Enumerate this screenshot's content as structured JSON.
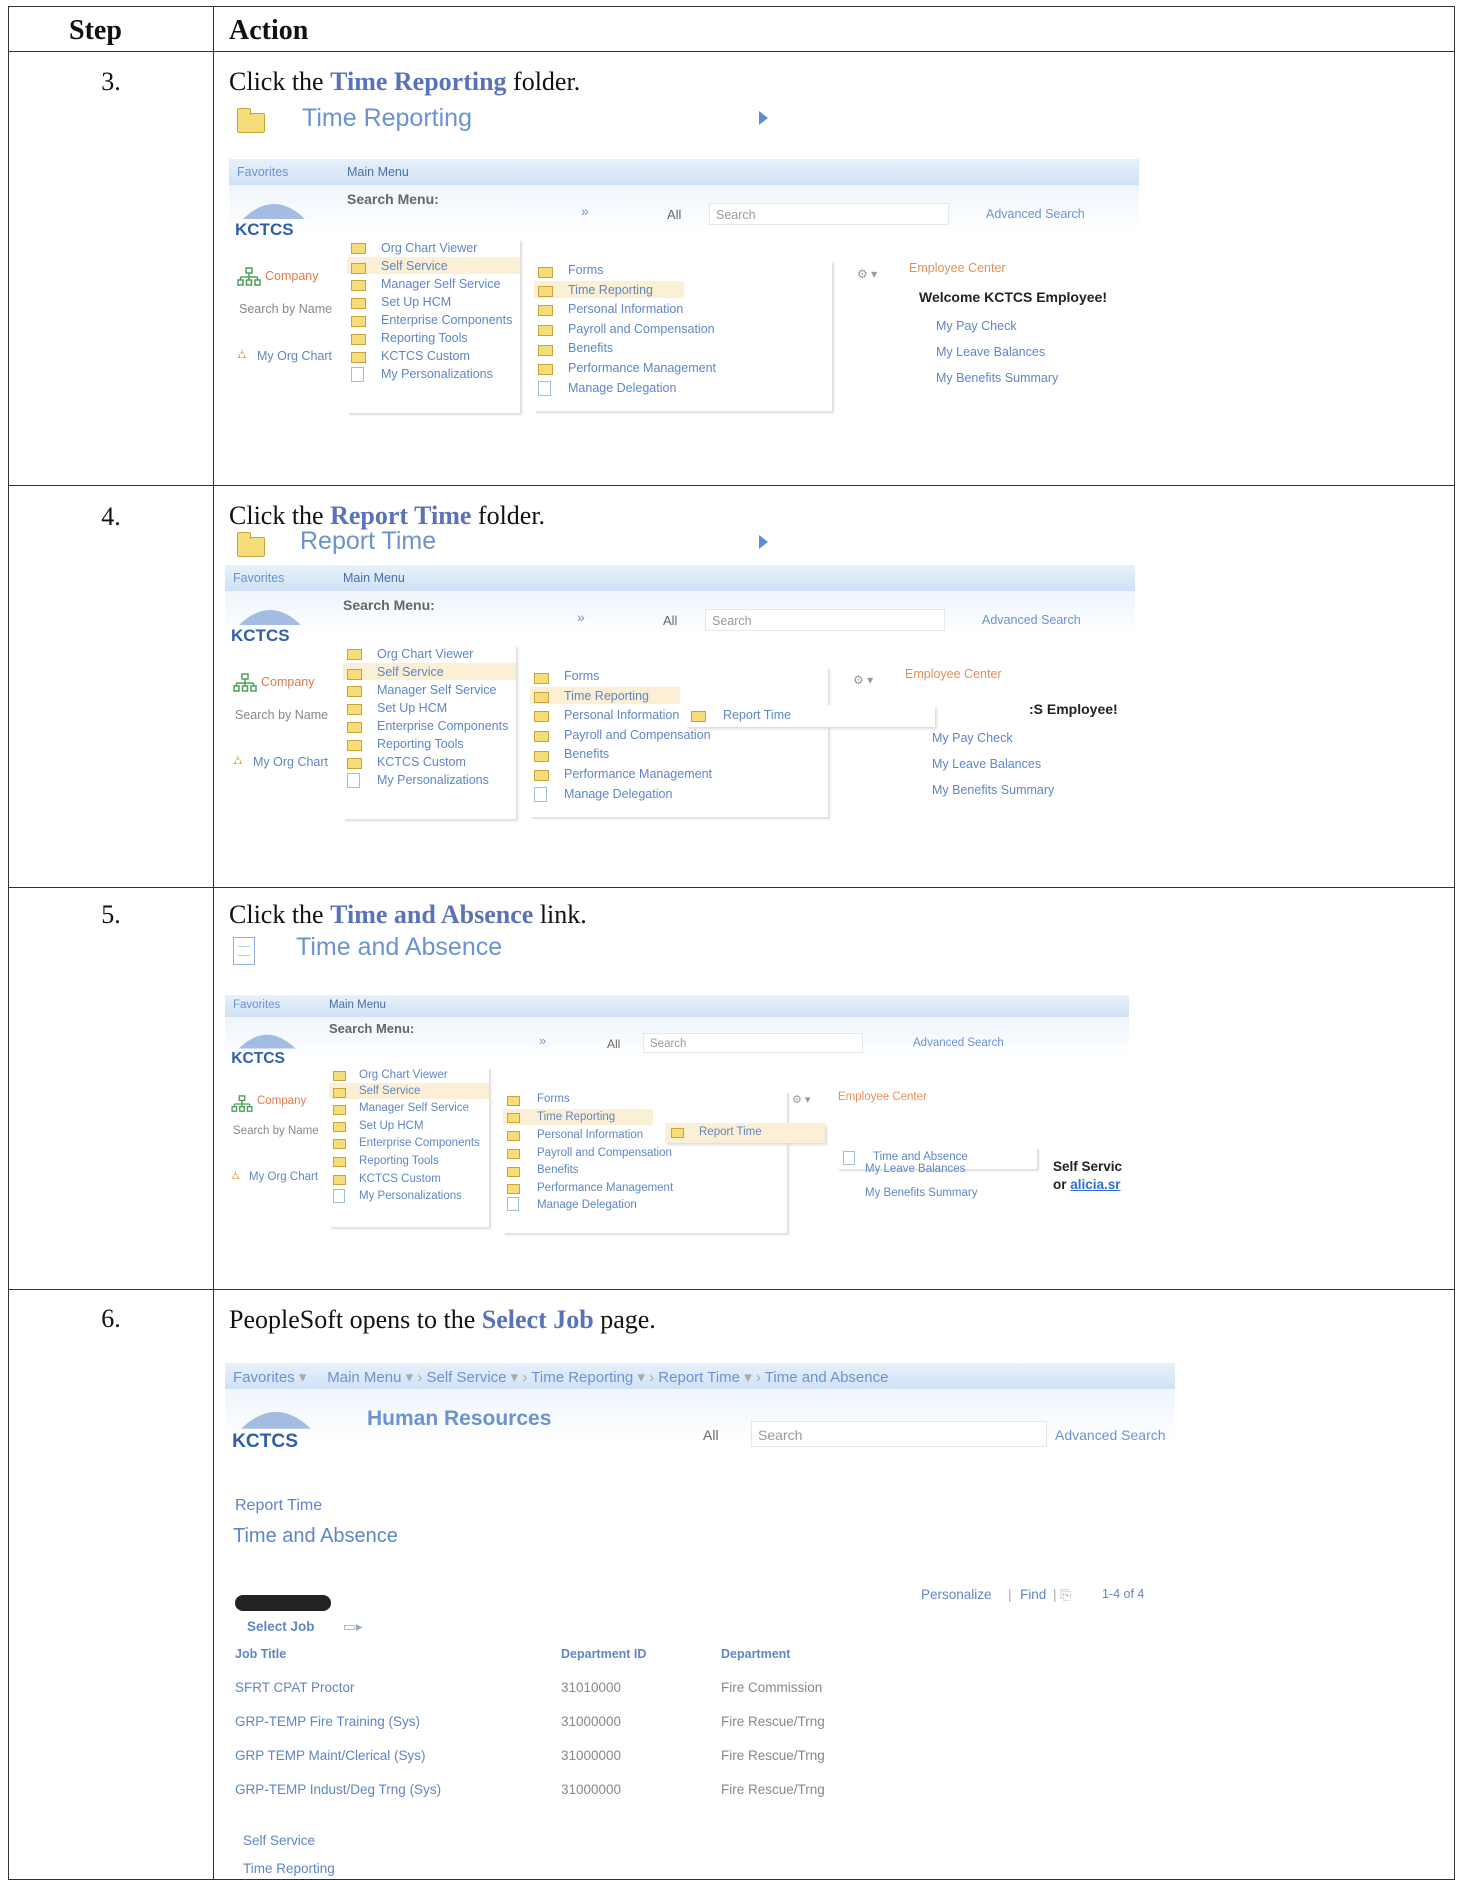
{
  "table": {
    "header_step": "Step",
    "header_action": "Action"
  },
  "steps": [
    {
      "num": "3.",
      "pre": "Click the ",
      "bold": "Time Reporting",
      "post": " folder.",
      "big_label": "Time Reporting"
    },
    {
      "num": "4.",
      "pre": "Click the ",
      "bold": "Report Time",
      "post": " folder.",
      "big_label": "Report Time"
    },
    {
      "num": "5.",
      "pre": "Click the ",
      "bold": "Time and Absence",
      "post": " link.",
      "big_label": "Time and Absence"
    },
    {
      "num": "6.",
      "pre": "PeopleSoft opens to the ",
      "bold": "Select Job",
      "post": " page."
    }
  ],
  "ps": {
    "favorites": "Favorites",
    "main_menu": "Main Menu",
    "search_menu": "Search Menu:",
    "all": "All",
    "search_placeholder": "Search",
    "advanced_search": "Advanced Search",
    "logo": "KCTCS",
    "company": "Company",
    "search_by_name": "Search by Name",
    "my_org_chart": "My Org Chart",
    "menu1": [
      "Org Chart Viewer",
      "Self Service",
      "Manager Self Service",
      "Set Up HCM",
      "Enterprise Components",
      "Reporting Tools",
      "KCTCS Custom",
      "My Personalizations"
    ],
    "menu2": [
      "Forms",
      "Time Reporting",
      "Personal Information",
      "Payroll and Compensation",
      "Benefits",
      "Performance Management",
      "Manage Delegation"
    ],
    "menu3_item": "Report Time",
    "menu4_item": "Time and Absence",
    "employee_center": "Employee Center",
    "welcome": "Welcome KCTCS Employee!",
    "welcome_partial": ":S Employee!",
    "links": [
      "My Pay Check",
      "My Leave Balances",
      "My Benefits Summary"
    ],
    "self_service_partial": "Self Servic",
    "or_text": "or ",
    "user_link_partial": "alicia.sr"
  },
  "page6": {
    "breadcrumb": [
      "Favorites",
      "Main Menu",
      "Self Service",
      "Time Reporting",
      "Report Time",
      "Time and Absence"
    ],
    "title": "Human Resources",
    "sub1": "Report Time",
    "sub2": "Time and Absence",
    "personalize": "Personalize",
    "find": "Find",
    "count": "1-4 of 4",
    "select_job": "Select Job",
    "cols": [
      "Job Title",
      "Department ID",
      "Department"
    ],
    "rows": [
      [
        "SFRT CPAT Proctor",
        "31010000",
        "Fire Commission"
      ],
      [
        "GRP-TEMP Fire Training (Sys)",
        "31000000",
        "Fire Rescue/Trng"
      ],
      [
        "GRP TEMP Maint/Clerical (Sys)",
        "31000000",
        "Fire Rescue/Trng"
      ],
      [
        "GRP-TEMP Indust/Deg Trng (Sys)",
        "31000000",
        "Fire Rescue/Trng"
      ]
    ],
    "bottom_links": [
      "Self Service",
      "Time Reporting"
    ]
  }
}
